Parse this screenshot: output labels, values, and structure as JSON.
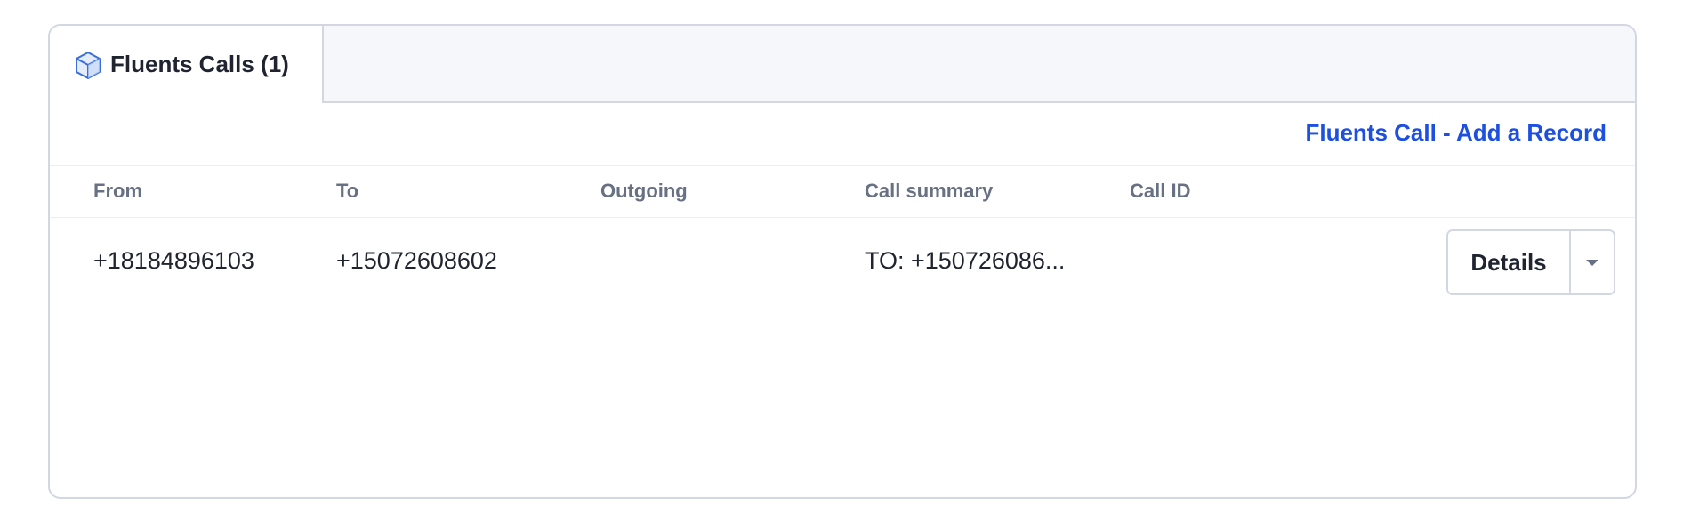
{
  "panel": {
    "tab": {
      "label": "Fluents Calls (1)",
      "icon": "cube-icon"
    },
    "add_record_link": "Fluents Call - Add a Record",
    "table": {
      "columns": [
        "From",
        "To",
        "Outgoing",
        "Call summary",
        "Call ID"
      ],
      "rows": [
        {
          "from": "+18184896103",
          "to": "+15072608602",
          "outgoing": "",
          "call_summary": "TO: +150726086...",
          "call_id": ""
        }
      ],
      "row_actions": {
        "details_label": "Details",
        "menu_icon": "caret-down-icon"
      }
    },
    "colors": {
      "accent": "#1d4fe0",
      "border": "#d3d7e3",
      "header_text": "#687083",
      "icon": "#3a6ed8"
    }
  }
}
